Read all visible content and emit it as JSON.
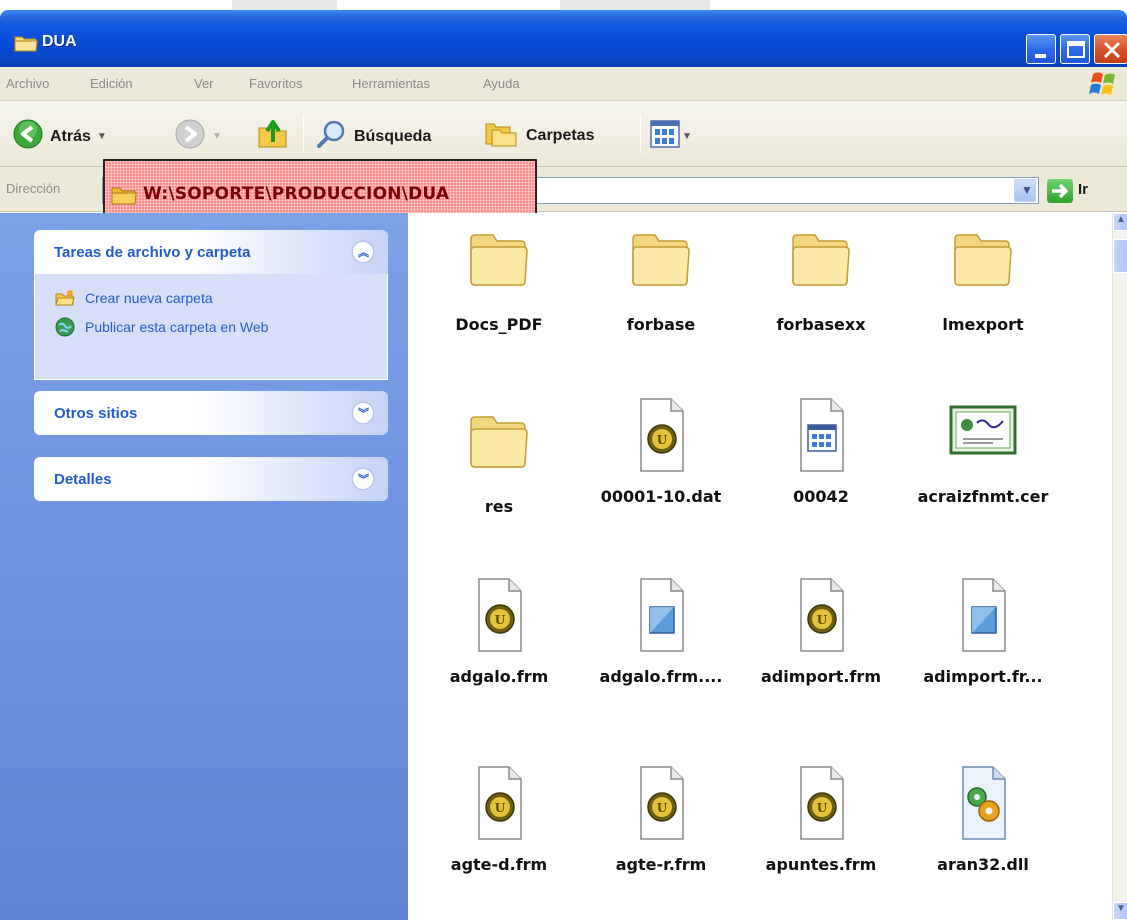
{
  "window": {
    "title": "DUA"
  },
  "menubar": {
    "items": [
      "Archivo",
      "Edición",
      "Ver",
      "Favoritos",
      "Herramientas",
      "Ayuda"
    ]
  },
  "toolbar": {
    "back_label": "Atrás",
    "search_label": "Búsqueda",
    "folders_label": "Carpetas"
  },
  "addressbar": {
    "label": "Dirección",
    "path": "W:\\SOPORTE\\PRODUCCION\\DUA",
    "go_label": "Ir"
  },
  "sidebar": {
    "panels": [
      {
        "title": "Tareas de archivo y carpeta",
        "expanded": true,
        "tasks": [
          "Crear nueva carpeta",
          "Publicar esta carpeta en Web"
        ]
      },
      {
        "title": "Otros sitios",
        "expanded": false
      },
      {
        "title": "Detalles",
        "expanded": false
      }
    ]
  },
  "files": [
    {
      "name": "Docs_PDF",
      "icon": "folder-icon"
    },
    {
      "name": "forbase",
      "icon": "folder-icon"
    },
    {
      "name": "forbasexx",
      "icon": "folder-icon"
    },
    {
      "name": "lmexport",
      "icon": "folder-icon"
    },
    {
      "name": "res",
      "icon": "folder-icon"
    },
    {
      "name": "00001-10.dat",
      "icon": "ultraedit-file-icon"
    },
    {
      "name": "00042",
      "icon": "app-window-file-icon"
    },
    {
      "name": "acraizfnmt.cer",
      "icon": "certificate-icon"
    },
    {
      "name": "adgalo.frm",
      "icon": "ultraedit-file-icon"
    },
    {
      "name": "adgalo.frm....",
      "icon": "generic-file-icon"
    },
    {
      "name": "adimport.frm",
      "icon": "ultraedit-file-icon"
    },
    {
      "name": "adimport.fr...",
      "icon": "generic-file-icon"
    },
    {
      "name": "agte-d.frm",
      "icon": "ultraedit-file-icon"
    },
    {
      "name": "agte-r.frm",
      "icon": "ultraedit-file-icon"
    },
    {
      "name": "apuntes.frm",
      "icon": "ultraedit-file-icon"
    },
    {
      "name": "aran32.dll",
      "icon": "dll-gear-icon"
    }
  ]
}
